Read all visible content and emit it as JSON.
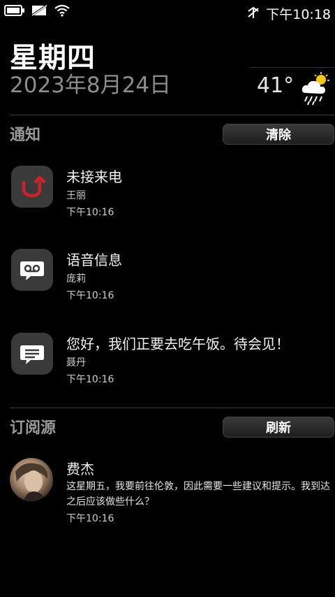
{
  "status_bar": {
    "time": "下午10:18"
  },
  "header": {
    "day": "星期四",
    "date": "2023年8月24日"
  },
  "weather": {
    "temperature": "41°",
    "icon": "rain-cloud-sun-icon"
  },
  "notifications": {
    "section_title": "通知",
    "clear_label": "清除",
    "items": [
      {
        "icon": "missed-call-icon",
        "title": "未接来电",
        "sender": "王丽",
        "time": "下午10:16"
      },
      {
        "icon": "voicemail-icon",
        "title": "语音信息",
        "sender": "庞莉",
        "time": "下午10:16"
      },
      {
        "icon": "message-icon",
        "title": "您好，我们正要去吃午饭。待会见！",
        "sender": "聂丹",
        "time": "下午10:16"
      }
    ]
  },
  "feeds": {
    "section_title": "订阅源",
    "refresh_label": "刷新",
    "items": [
      {
        "name": "费杰",
        "message": "这星期五，我要前往伦敦，因此需要一些建议和提示。我到达之后应该做些什么？",
        "time": "下午10:16"
      }
    ]
  },
  "colors": {
    "background": "#000000",
    "accent_missed_call": "#d0202a",
    "tile": "#3a3a3a"
  }
}
